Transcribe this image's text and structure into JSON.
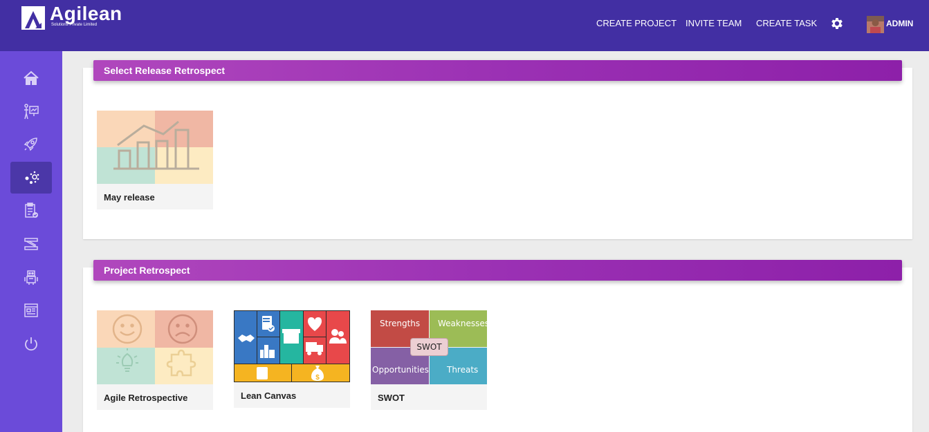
{
  "header": {
    "logo_name": "Agilean",
    "logo_tagline": "Solutions Private Limited",
    "nav": [
      "CREATE PROJECT",
      "INVITE TEAM",
      "CREATE TASK"
    ],
    "user": "ADMIN",
    "colors": {
      "bar": "#422fa3",
      "sidebar": "#6b4bd9",
      "accent": "#9b31b4"
    }
  },
  "sidebar": {
    "items": [
      {
        "icon": "home-icon"
      },
      {
        "icon": "presentation-icon"
      },
      {
        "icon": "rocket-icon"
      },
      {
        "icon": "retrospect-icon",
        "active": true
      },
      {
        "icon": "clipboard-check-icon"
      },
      {
        "icon": "sprint-icon"
      },
      {
        "icon": "robot-icon"
      },
      {
        "icon": "report-icon"
      },
      {
        "icon": "power-icon"
      }
    ]
  },
  "release_section": {
    "title": "Select Release Retrospect",
    "tiles": [
      {
        "label": "May release"
      }
    ]
  },
  "project_section": {
    "title": "Project Retrospect",
    "tiles": [
      {
        "label": "Agile Retrospective"
      },
      {
        "label": "Lean Canvas"
      },
      {
        "label": "SWOT"
      }
    ],
    "swot": {
      "strengths": "Strengths",
      "weaknesses": "Weaknesses",
      "opportunities": "Opportunities",
      "threats": "Threats",
      "center": "SWOT"
    }
  }
}
